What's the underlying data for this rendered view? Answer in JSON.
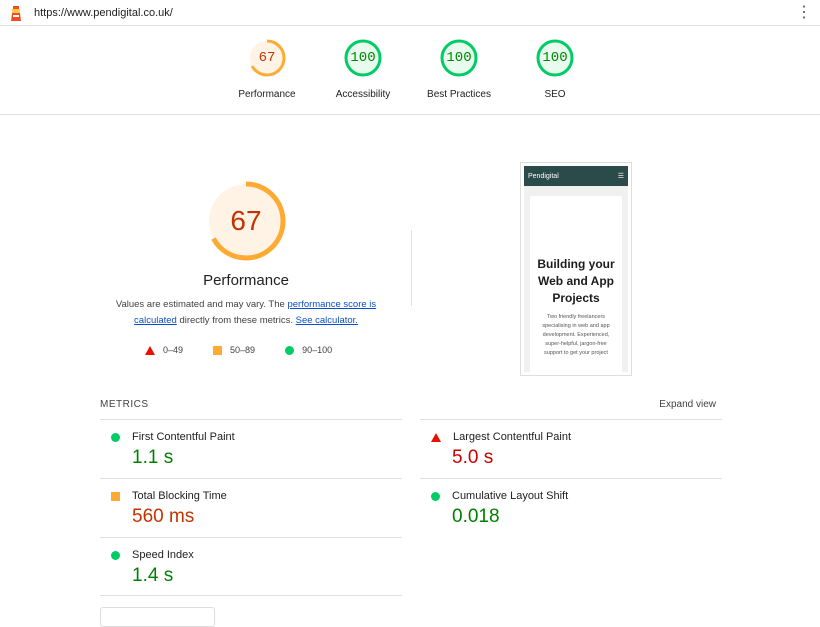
{
  "topbar": {
    "url": "https://www.pendigital.co.uk/"
  },
  "summary": [
    {
      "label": "Performance",
      "score": "67",
      "value": 0.67,
      "color": "#fa3",
      "text_color": "#c33300"
    },
    {
      "label": "Accessibility",
      "score": "100",
      "value": 1.0,
      "color": "#0c6",
      "text_color": "#008800"
    },
    {
      "label": "Best Practices",
      "score": "100",
      "value": 1.0,
      "color": "#0c6",
      "text_color": "#008800"
    },
    {
      "label": "SEO",
      "score": "100",
      "value": 1.0,
      "color": "#0c6",
      "text_color": "#008800"
    }
  ],
  "performance": {
    "score": "67",
    "value": 0.67,
    "title": "Performance",
    "desc_1": "Values are estimated and may vary. The ",
    "link_1": "performance score is calculated",
    "desc_2": " directly from these metrics. ",
    "link_2": "See calculator.",
    "legend": [
      "0–49",
      "50–89",
      "90–100"
    ]
  },
  "screenshot": {
    "brand": "Pendigital",
    "heading": "Building your Web and App Projects",
    "text": "Two friendly freelancers specialising in web and app development. Experienced, super-helpful, jargon-free support to get your project"
  },
  "metrics": {
    "header": "METRICS",
    "expand": "Expand view",
    "items": [
      {
        "name": "First Contentful Paint",
        "value": "1.1 s",
        "status": "pass"
      },
      {
        "name": "Largest Contentful Paint",
        "value": "5.0 s",
        "status": "fail"
      },
      {
        "name": "Total Blocking Time",
        "value": "560 ms",
        "status": "average"
      },
      {
        "name": "Cumulative Layout Shift",
        "value": "0.018",
        "status": "pass"
      },
      {
        "name": "Speed Index",
        "value": "1.4 s",
        "status": "pass"
      }
    ]
  }
}
